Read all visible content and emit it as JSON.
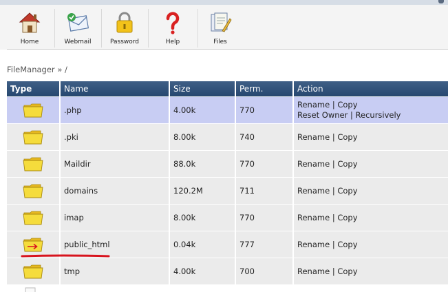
{
  "toolbar": {
    "items": [
      {
        "label": "Home",
        "icon": "home-icon"
      },
      {
        "label": "Webmail",
        "icon": "webmail-icon"
      },
      {
        "label": "Password",
        "icon": "padlock-icon"
      },
      {
        "label": "Help",
        "icon": "question-mark-icon"
      },
      {
        "label": "Files",
        "icon": "files-icon"
      }
    ]
  },
  "breadcrumb": {
    "root": "FileManager",
    "sep": "»",
    "path": "/"
  },
  "table": {
    "headers": {
      "type": "Type",
      "name": "Name",
      "size": "Size",
      "perm": "Perm.",
      "action": "Action"
    },
    "rows": [
      {
        "name": ".php",
        "size": "4.00k",
        "perm": "770",
        "rename": "Rename",
        "sep": "|",
        "copy": "Copy",
        "reset_owner": "Reset Owner",
        "recursively": "Recursively",
        "selected": true
      },
      {
        "name": ".pki",
        "size": "8.00k",
        "perm": "740",
        "rename": "Rename",
        "sep": "|",
        "copy": "Copy"
      },
      {
        "name": "Maildir",
        "size": "88.0k",
        "perm": "770",
        "rename": "Rename",
        "sep": "|",
        "copy": "Copy"
      },
      {
        "name": "domains",
        "size": "120.2M",
        "perm": "711",
        "rename": "Rename",
        "sep": "|",
        "copy": "Copy"
      },
      {
        "name": "imap",
        "size": "8.00k",
        "perm": "770",
        "rename": "Rename",
        "sep": "|",
        "copy": "Copy"
      },
      {
        "name": "public_html",
        "size": "0.04k",
        "perm": "777",
        "rename": "Rename",
        "sep": "|",
        "copy": "Copy",
        "symlink": true
      },
      {
        "name": "tmp",
        "size": "4.00k",
        "perm": "700",
        "rename": "Rename",
        "sep": "|",
        "copy": "Copy"
      }
    ]
  },
  "colors": {
    "header": "#2f5078",
    "row": "#ebebeb",
    "selected_row": "#c8cdf3",
    "folder": "#f5dc3c",
    "annotation": "#d8141e"
  }
}
